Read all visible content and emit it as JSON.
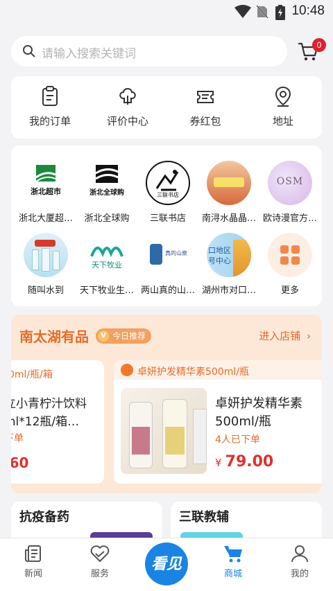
{
  "status_bar": {
    "time": "10:48"
  },
  "search": {
    "placeholder": "请输入搜索关键词"
  },
  "cart": {
    "badge": "0"
  },
  "quick_actions": [
    {
      "label": "我的订单",
      "icon": "order-icon"
    },
    {
      "label": "评价中心",
      "icon": "review-icon"
    },
    {
      "label": "券红包",
      "icon": "coupon-icon"
    },
    {
      "label": "地址",
      "icon": "location-icon"
    }
  ],
  "stores": [
    {
      "name": "浙北大厦超…",
      "logo_text": "浙北超市"
    },
    {
      "name": "浙北全球购",
      "logo_text": "浙北全球购"
    },
    {
      "name": "三联书店",
      "logo_text": "三联书店"
    },
    {
      "name": "南浔水晶晶…",
      "logo_text": ""
    },
    {
      "name": "欧诗漫官方…",
      "logo_text": "OSM"
    },
    {
      "name": "随叫水到",
      "logo_text": ""
    },
    {
      "name": "天下牧业生…",
      "logo_text": "天下牧业"
    },
    {
      "name": "两山真的山…",
      "logo_text": "真的山泉"
    },
    {
      "name": "湖州市对口…",
      "logo_text": "口地区 号中心"
    },
    {
      "name": "更多",
      "logo_text": ""
    }
  ],
  "promo": {
    "title": "南太湖有品",
    "tag": "今日推荐",
    "tag_icon": "V",
    "enter_label": "进入店铺",
    "left_card": {
      "header": "0ml/瓶/箱",
      "name_line1": "立小青柠汁饮料",
      "name_line2": "ml*12瓶/箱…",
      "sold": "下单",
      "price": ".60"
    },
    "main_card": {
      "header": "卓妍护发精华素500ml/瓶",
      "name_line1": "卓妍护发精华素",
      "name_line2": "500ml/瓶",
      "sold": "4人已下单",
      "price_symbol": "¥",
      "price": "79.00"
    }
  },
  "sections": [
    {
      "title": "抗疫备药"
    },
    {
      "title": "三联教辅"
    }
  ],
  "tabs": [
    {
      "label": "新闻",
      "icon": "news-icon"
    },
    {
      "label": "服务",
      "icon": "heart-icon"
    },
    {
      "label": "商城",
      "icon": "cart-icon"
    },
    {
      "label": "我的",
      "icon": "user-icon"
    }
  ],
  "center_button": {
    "label": "看见"
  },
  "colors": {
    "accent": "#1a84e4",
    "promo_orange": "#e36d2a",
    "price_red": "#e0302e"
  }
}
